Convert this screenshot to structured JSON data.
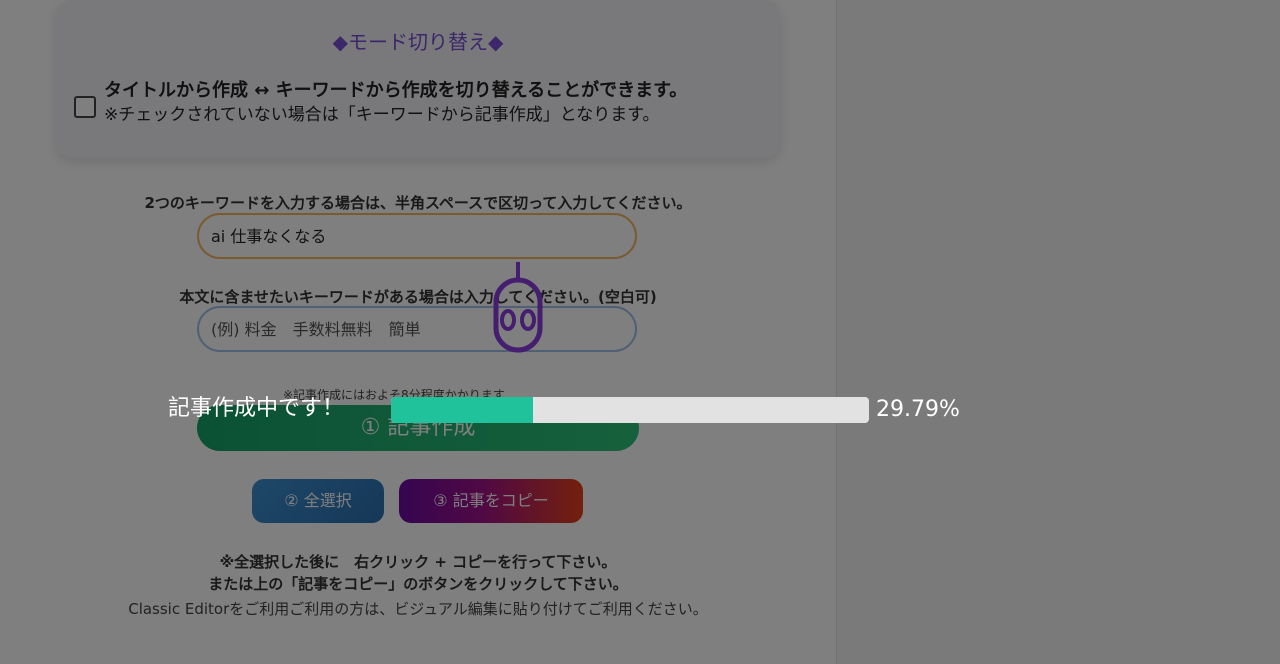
{
  "mode_card": {
    "title": "◆モード切り替え◆",
    "checked": false,
    "desc_line1": "タイトルから作成 ↔ キーワードから作成を切り替えることができます。",
    "desc_line2": "※チェックされていない場合は「キーワードから記事作成」となります。"
  },
  "keyword_section": {
    "label": "2つのキーワードを入力する場合は、半角スペースで区切って入力してください。",
    "value": "ai 仕事なくなる"
  },
  "body_keyword_section": {
    "label": "本文に含ませたいキーワードがある場合は入力してください。(空白可)",
    "placeholder": "(例) 料金　手数料無料　簡単"
  },
  "time_note": "※記事作成にはおよそ8分程度かかります",
  "buttons": {
    "create": "① 記事作成",
    "select_all": "② 全選択",
    "copy": "③ 記事をコピー"
  },
  "notes": {
    "line1": "※全選択した後に　右クリック + コピーを行って下さい。",
    "line2": "または上の「記事をコピー」のボタンをクリックして下さい。",
    "line3": "Classic Editorをご利用ご利用の方は、ビジュアル編集に貼り付けてご利用ください。"
  },
  "progress": {
    "status": "記事作成中です！",
    "percent_text": "29.79%",
    "fraction": 0.2979
  },
  "colors": {
    "accent_purple": "#7b4fd6",
    "progress_fill": "#1fc29b",
    "create_button": "#16a36a"
  },
  "icons": {
    "mascot": "robot-icon"
  }
}
